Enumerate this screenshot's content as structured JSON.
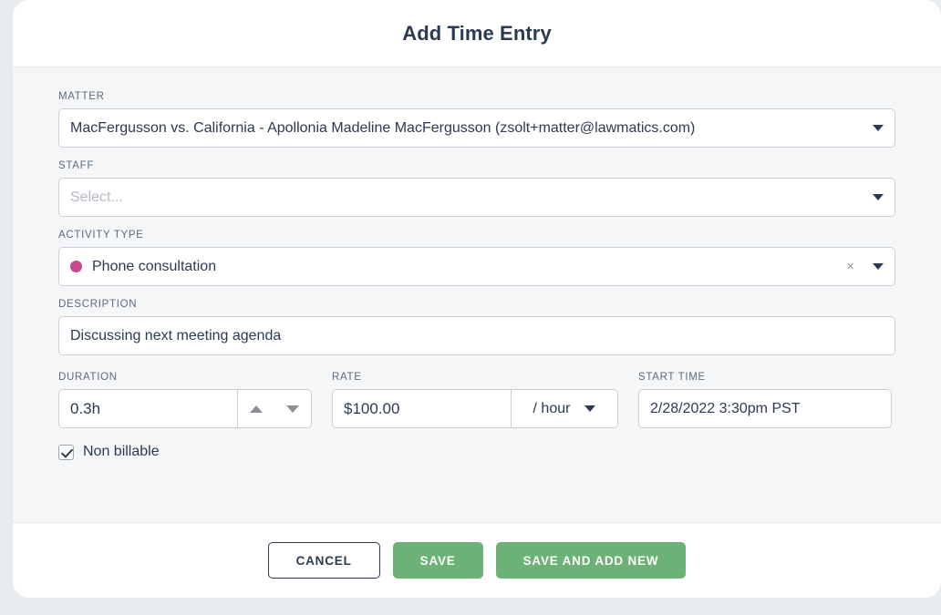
{
  "header": {
    "title": "Add Time Entry"
  },
  "fields": {
    "matter": {
      "label": "MATTER",
      "value": "MacFergusson vs. California - Apollonia Madeline MacFergusson (zsolt+matter@lawmatics.com)",
      "caret_icon": "chevron-down-icon"
    },
    "staff": {
      "label": "STAFF",
      "placeholder": "Select...",
      "value": "",
      "caret_icon": "chevron-down-icon"
    },
    "activity_type": {
      "label": "ACTIVITY TYPE",
      "value": "Phone consultation",
      "dot_color": "#c9478b",
      "clear_icon": "×",
      "caret_icon": "chevron-down-icon"
    },
    "description": {
      "label": "DESCRIPTION",
      "value": "Discussing next meeting agenda"
    },
    "duration": {
      "label": "DURATION",
      "value": "0.3h",
      "increment_icon": "arrow-up-icon",
      "decrement_icon": "arrow-down-icon"
    },
    "rate": {
      "label": "RATE",
      "value": "$100.00",
      "unit": "/ hour",
      "caret_icon": "chevron-down-icon"
    },
    "start_time": {
      "label": "START TIME",
      "value": "2/28/2022 3:30pm PST"
    },
    "non_billable": {
      "label": "Non billable",
      "checked": true
    }
  },
  "footer": {
    "cancel_label": "CANCEL",
    "save_label": "SAVE",
    "save_add_new_label": "SAVE AND ADD NEW"
  },
  "colors": {
    "accent_green": "#6cb176",
    "title_navy": "#2b3a52",
    "activity_dot": "#c9478b",
    "body_background": "#f5f6f8"
  }
}
